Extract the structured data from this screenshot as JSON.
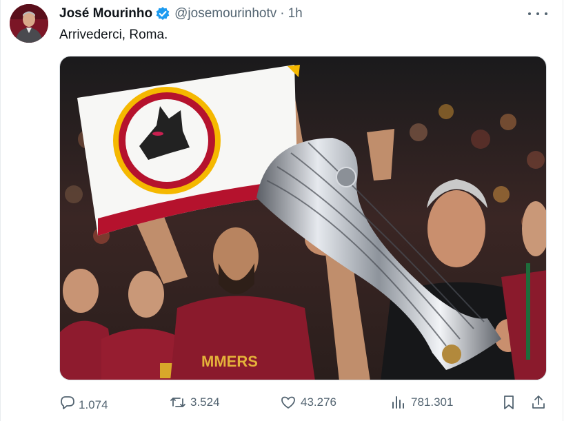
{
  "post": {
    "author_name": "José Mourinho",
    "handle": "@josemourinhotv",
    "separator": "·",
    "time": "1h",
    "text": "Arrivederci, Roma.",
    "verified": true,
    "avatar_icon": "profile-photo",
    "more_icon": "more-options-icon"
  },
  "actions": {
    "replies": "1.074",
    "reposts": "3.524",
    "likes": "43.276",
    "views": "781.301"
  },
  "icons": {
    "reply": "reply-icon",
    "repost": "repost-icon",
    "like": "heart-icon",
    "views": "views-chart-icon",
    "bookmark": "bookmark-icon",
    "share": "share-icon",
    "verified": "verified-badge-icon"
  },
  "colors": {
    "text": "#0f1419",
    "muted": "#536471",
    "verified": "#1d9bf0",
    "jersey": "#8e1b2e",
    "flag_red": "#b5122d",
    "flag_yellow": "#f5b800"
  }
}
